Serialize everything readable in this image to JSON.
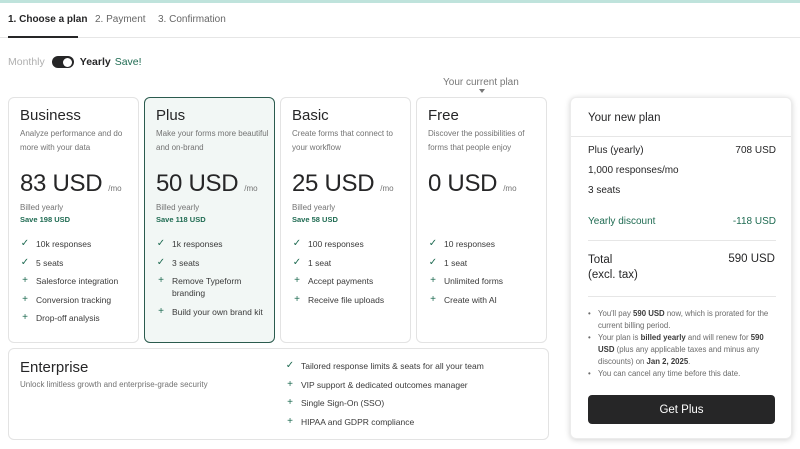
{
  "steps": [
    {
      "label": "1. Choose a plan"
    },
    {
      "label": "2. Payment"
    },
    {
      "label": "3. Confirmation"
    }
  ],
  "billing": {
    "monthly_label": "Monthly",
    "yearly_label": "Yearly",
    "save_label": "Save!",
    "selected": "Yearly"
  },
  "current_plan_label": "Your current plan",
  "plans": [
    {
      "name": "Business",
      "description": "Analyze performance and do more with your data",
      "price": "83 USD",
      "per": "/mo",
      "billed": "Billed yearly",
      "save": "Save 198 USD",
      "features": [
        {
          "icon": "check-icon",
          "text": "10k responses"
        },
        {
          "icon": "check-icon",
          "text": "5 seats"
        },
        {
          "icon": "plus-icon",
          "text": "Salesforce integration"
        },
        {
          "icon": "plus-icon",
          "text": "Conversion tracking"
        },
        {
          "icon": "plus-icon",
          "text": "Drop-off analysis"
        }
      ]
    },
    {
      "name": "Plus",
      "description": "Make your forms more beautiful and on-brand",
      "price": "50 USD",
      "per": "/mo",
      "billed": "Billed yearly",
      "save": "Save 118 USD",
      "features": [
        {
          "icon": "check-icon",
          "text": "1k responses"
        },
        {
          "icon": "check-icon",
          "text": "3 seats"
        },
        {
          "icon": "plus-icon",
          "text": "Remove Typeform branding"
        },
        {
          "icon": "plus-icon",
          "text": "Build your own brand kit"
        }
      ]
    },
    {
      "name": "Basic",
      "description": "Create forms that connect to your workflow",
      "price": "25 USD",
      "per": "/mo",
      "billed": "Billed yearly",
      "save": "Save 58 USD",
      "features": [
        {
          "icon": "check-icon",
          "text": "100 responses"
        },
        {
          "icon": "check-icon",
          "text": "1 seat"
        },
        {
          "icon": "plus-icon",
          "text": "Accept payments"
        },
        {
          "icon": "plus-icon",
          "text": "Receive file uploads"
        }
      ]
    },
    {
      "name": "Free",
      "description": "Discover the possibilities of forms that people enjoy",
      "price": "0 USD",
      "per": "/mo",
      "billed": "",
      "save": "",
      "features": [
        {
          "icon": "check-icon",
          "text": "10 responses"
        },
        {
          "icon": "check-icon",
          "text": "1 seat"
        },
        {
          "icon": "plus-icon",
          "text": "Unlimited forms"
        },
        {
          "icon": "plus-icon",
          "text": "Create with AI"
        }
      ]
    }
  ],
  "enterprise": {
    "name": "Enterprise",
    "description": "Unlock limitless growth and enterprise-grade security",
    "features": [
      {
        "icon": "check-icon",
        "text": "Tailored response limits & seats for all your team"
      },
      {
        "icon": "plus-icon",
        "text": "VIP support & dedicated outcomes manager"
      },
      {
        "icon": "plus-icon",
        "text": "Single Sign-On (SSO)"
      },
      {
        "icon": "plus-icon",
        "text": "HIPAA and GDPR compliance"
      }
    ]
  },
  "summary": {
    "title": "Your new plan",
    "plan_label": "Plus (yearly)",
    "plan_price": "708 USD",
    "responses": "1,000 responses/mo",
    "seats": "3 seats",
    "discount_label": "Yearly discount",
    "discount_value": "-118 USD",
    "total_label": "Total",
    "total_sub": "(excl. tax)",
    "total_value": "590 USD",
    "notes": {
      "n1_a": "You'll pay ",
      "n1_b": "590 USD",
      "n1_c": " now, which is prorated for the current billing period.",
      "n2_a": "Your plan is ",
      "n2_b": "billed yearly",
      "n2_c": " and will renew for ",
      "n2_d": "590 USD",
      "n2_e": " (plus any applicable taxes and minus any discounts) on ",
      "n2_f": "Jan 2, 2025",
      "n2_g": ".",
      "n3": "You can cancel any time before this date."
    },
    "cta": "Get Plus"
  },
  "colors": {
    "accent_green": "#1f6b52",
    "selected_border": "#2b5b4e",
    "selected_bg": "#f2f7f5",
    "dark": "#262627"
  }
}
